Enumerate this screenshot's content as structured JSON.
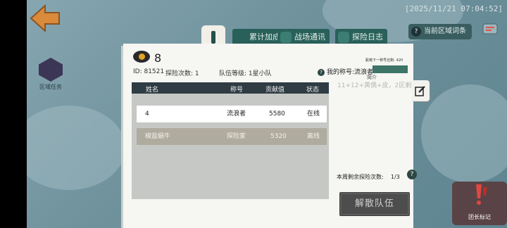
{
  "header": {
    "timestamp": "[2025/11/21 07:04:52]",
    "region_task_label": "区域任务",
    "current_area_label": "当前区域词条"
  },
  "tabs": [
    {
      "label": "累计加成"
    },
    {
      "label": "战场通讯"
    },
    {
      "label": "探险日志"
    }
  ],
  "team": {
    "eye_count": "8",
    "id_text": "ID: 81521",
    "explore_count_text": "探险次数: 1",
    "team_level_text": "队伍等级: 1星小队",
    "nickname_text": "我的称号:流浪者",
    "next_title_text": "距离下一称号还剩:",
    "next_title_points": "420",
    "intro_label": "简介",
    "intro_text": "11+12+黄偶+皮，2区剩"
  },
  "table": {
    "headers": [
      "姓名",
      "称号",
      "贡献值",
      "状态"
    ],
    "rows": [
      {
        "name": "4",
        "title": "流浪者",
        "contribution": "5580",
        "status": "在线"
      },
      {
        "name": "椒盐蜗牛",
        "title": "探险家",
        "contribution": "5320",
        "status": "离线"
      }
    ]
  },
  "footer": {
    "weekly_text": "本周剩余探险次数:",
    "weekly_value": "1/3",
    "disband_label": "解散队伍",
    "leader_mark_label": "团长标记"
  },
  "colors": {
    "accent": "#29605a",
    "offline_row": "#b0ab9f",
    "header_dark": "#2f3c43"
  },
  "icons": [
    "back-arrow-icon",
    "region-task-icon",
    "info-icon",
    "chat-icon",
    "map-icon",
    "eye-icon",
    "question-icon",
    "edit-icon",
    "leader-mark-icon"
  ]
}
